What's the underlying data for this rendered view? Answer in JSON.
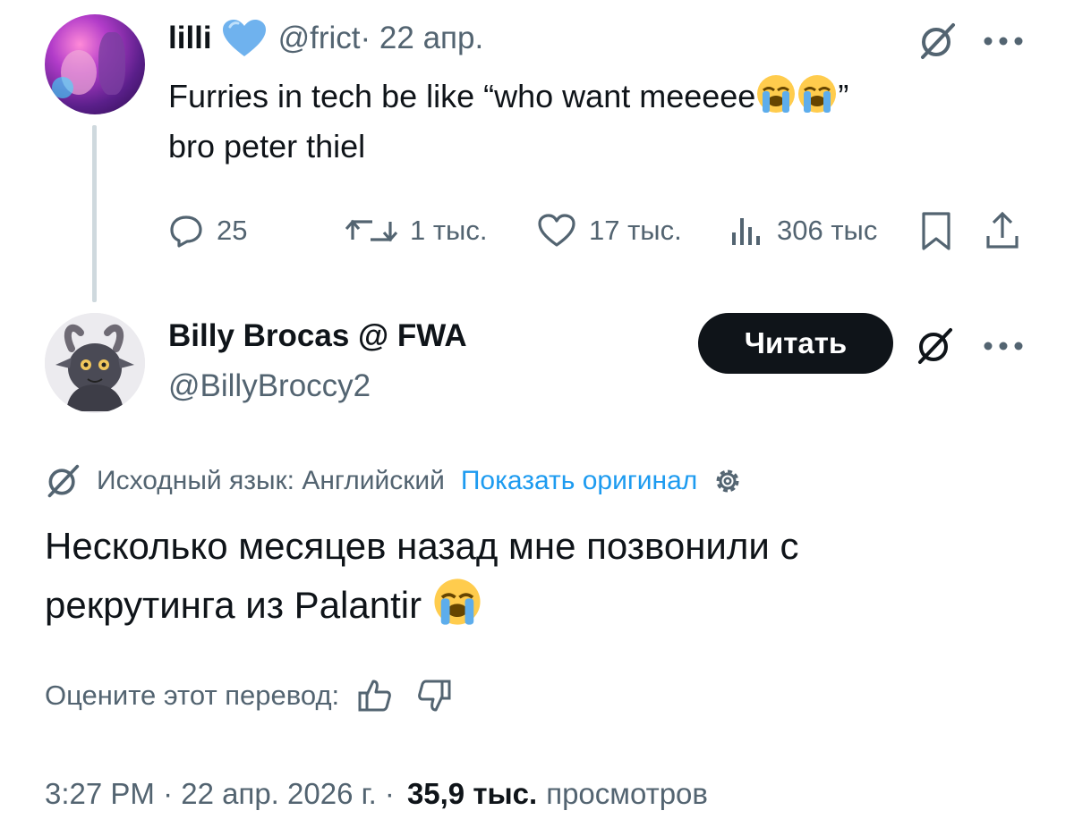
{
  "parent_tweet": {
    "author_name": "lilli",
    "handle": "@frict",
    "date": " · 22 апр.",
    "text_line1": "Furries in tech be like “who want meeeee",
    "text_line1_end": "”",
    "text_line2": "bro peter thiel",
    "emoji": "loudly-crying-face",
    "replies": "25",
    "reposts": "1 тыс.",
    "likes": "17 тыс.",
    "views": "306 тыс"
  },
  "tweet": {
    "author_name": "Billy Brocas @ FWA",
    "handle": "@BillyBroccy2",
    "follow_label": "Читать",
    "source_language": "Исходный язык: Английский",
    "show_original": "Показать оригинал",
    "text_line1": "Несколько месяцев назад мне позвонили с",
    "text_line2": "рекрутинга из Palantir ",
    "rate_translation": "Оцените этот перевод:",
    "time_date": "3:27 PM · 22 апр. 2026 г. · ",
    "views_count": "35,9 тыс.",
    "views_label": "просмотров"
  },
  "colors": {
    "text": "#0f1419",
    "secondary": "#536471",
    "link": "#1d9bf0",
    "verified": "#6fb2ee",
    "button": "#0f1419"
  },
  "icons": {
    "verified": "verified-heart-icon",
    "grok": "grok-icon",
    "more": "more-icon",
    "reply": "reply-icon",
    "repost": "repost-icon",
    "like": "like-icon",
    "views": "views-icon",
    "bookmark": "bookmark-icon",
    "share": "share-icon",
    "gear": "gear-icon",
    "thumbs_up": "thumbs-up-icon",
    "thumbs_down": "thumbs-down-icon"
  }
}
